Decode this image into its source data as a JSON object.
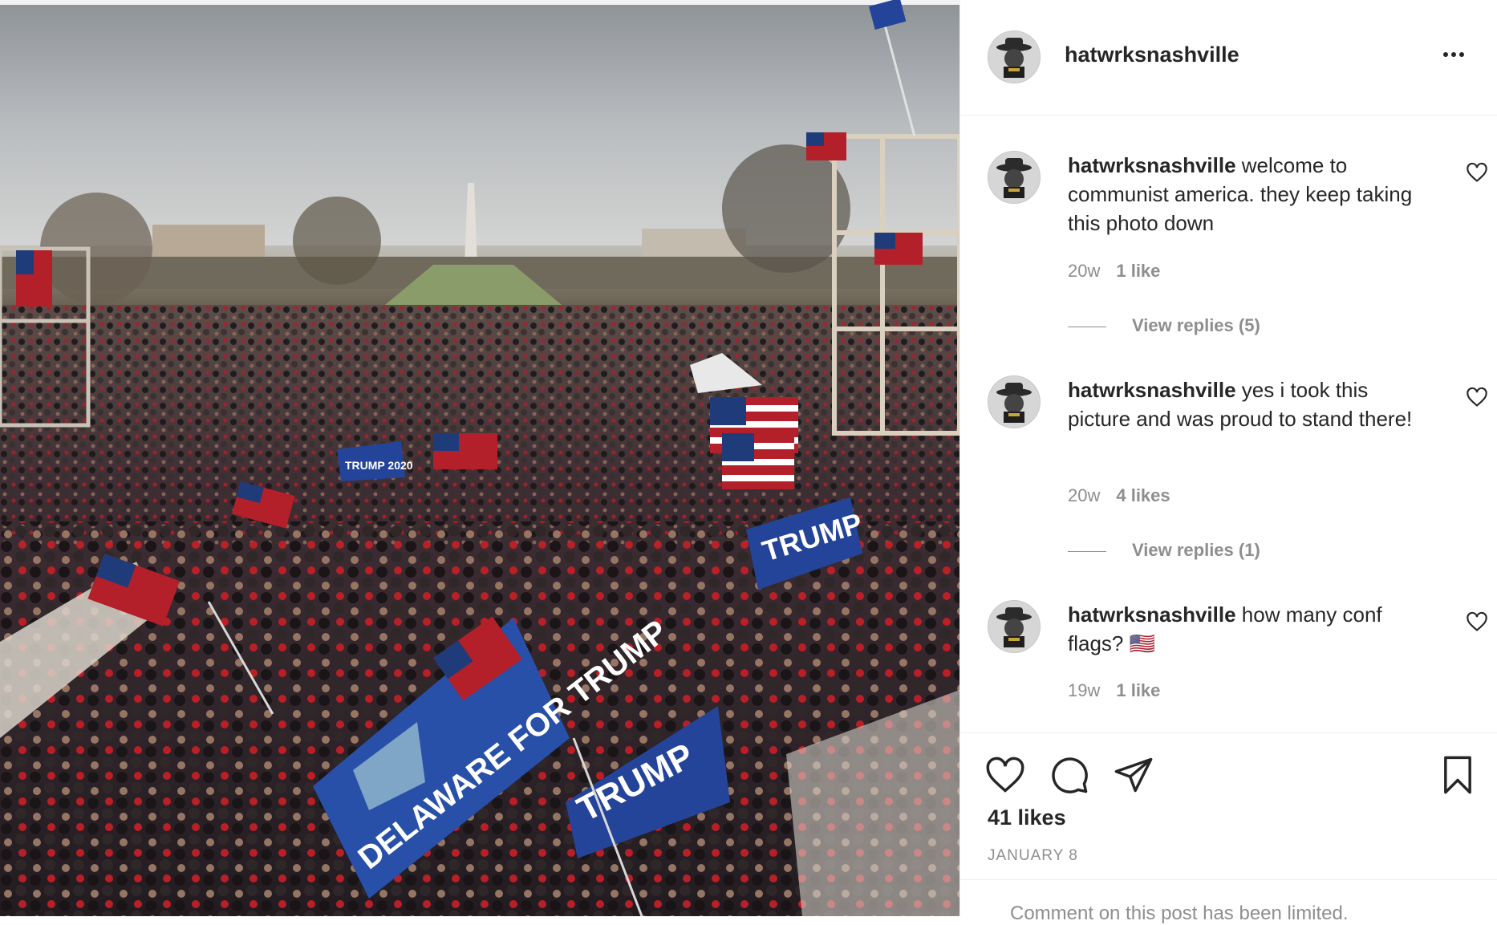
{
  "post": {
    "username": "hatwrksnashville",
    "avatar_icon": "hat-logo-icon",
    "more_icon": "more-options-icon",
    "likes_count": "41 likes",
    "date": "JANUARY 8",
    "add_comment_placeholder": "Comment on this post has been limited."
  },
  "comments": [
    {
      "username": "hatwrksnashville",
      "text": " welcome to communist america. they keep taking this photo down",
      "age": "20w",
      "likes": "1 like",
      "replies": "View replies (5)"
    },
    {
      "username": "hatwrksnashville",
      "text": " yes i took this picture and was proud to stand there!",
      "age": "20w",
      "likes": "4 likes",
      "replies": "View replies (1)"
    },
    {
      "username": "hatwrksnashville",
      "text": " how many conf flags? 🇺🇸",
      "age": "19w",
      "likes": "1 like"
    }
  ],
  "photo_flags": {
    "delaware_flag": "DELAWARE FOR TRUMP",
    "trump_flag_1": "TRUMP",
    "trump_flag_2": "TRUMP 2020",
    "trump_flag_3": "TRUMP"
  },
  "icons": {
    "like": "heart-icon",
    "comment": "comment-icon",
    "share": "paper-plane-icon",
    "save": "bookmark-icon"
  },
  "colors": {
    "text": "#262626",
    "muted": "#8e8e8e",
    "border": "#efefef"
  }
}
